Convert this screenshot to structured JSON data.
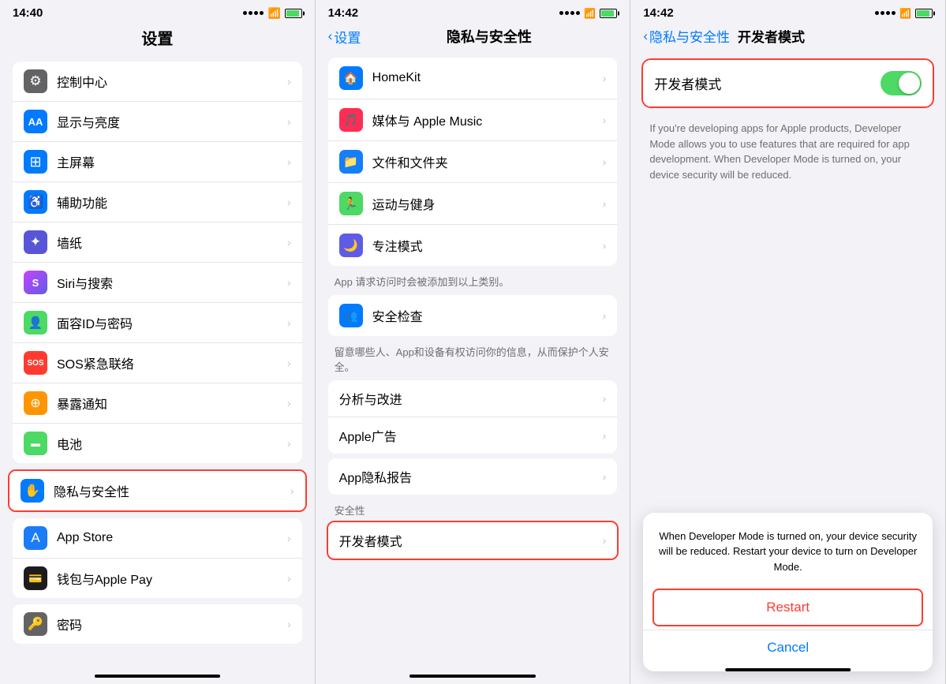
{
  "panel1": {
    "time": "14:40",
    "title": "设置",
    "items": [
      {
        "icon": "⚙",
        "iconClass": "ic-control",
        "label": "控制中心",
        "iconText": "◉"
      },
      {
        "icon": "AA",
        "iconClass": "ic-display",
        "label": "显示与亮度",
        "iconText": "AA"
      },
      {
        "icon": "⊞",
        "iconClass": "ic-home",
        "label": "主屏幕",
        "iconText": "⊞"
      },
      {
        "icon": "♿",
        "iconClass": "ic-accessibility",
        "label": "辅助功能",
        "iconText": "♿"
      },
      {
        "icon": "🖼",
        "iconClass": "ic-wallpaper",
        "label": "墙纸",
        "iconText": "✦"
      },
      {
        "icon": "S",
        "iconClass": "ic-siri",
        "label": "Siri与搜索",
        "iconText": "S"
      },
      {
        "icon": "👤",
        "iconClass": "ic-faceid",
        "label": "面容ID与密码",
        "iconText": "👤"
      },
      {
        "icon": "SOS",
        "iconClass": "ic-sos",
        "label": "SOS紧急联络",
        "iconText": "SOS"
      },
      {
        "icon": "⊕",
        "iconClass": "ic-exposure",
        "label": "暴露通知",
        "iconText": "⊕"
      },
      {
        "icon": "▬",
        "iconClass": "ic-battery",
        "label": "电池",
        "iconText": "▬"
      },
      {
        "icon": "✋",
        "iconClass": "ic-privacy",
        "label": "隐私与安全性",
        "iconText": "✋"
      },
      {
        "icon": "A",
        "iconClass": "ic-appstore",
        "label": "App Store",
        "iconText": "A"
      },
      {
        "icon": "💳",
        "iconClass": "ic-wallet",
        "label": "钱包与Apple Pay",
        "iconText": "💳"
      },
      {
        "icon": "🔑",
        "iconClass": "ic-passcode",
        "label": "密码",
        "iconText": "🔑"
      }
    ]
  },
  "panel2": {
    "time": "14:42",
    "backLabel": "设置",
    "title": "隐私与安全性",
    "items": [
      {
        "icon": "🏠",
        "iconClass": "ic-home",
        "label": "HomeKit",
        "iconText": "🏠"
      },
      {
        "icon": "🎵",
        "iconClass": "ic-sos",
        "label": "媒体与 Apple Music",
        "iconText": "🎵"
      },
      {
        "icon": "📁",
        "iconClass": "ic-appstore",
        "label": "文件和文件夹",
        "iconText": "📁"
      },
      {
        "icon": "🏃",
        "iconClass": "ic-faceid",
        "label": "运动与健身",
        "iconText": "🏃"
      },
      {
        "icon": "🌙",
        "iconClass": "ic-wallpaper",
        "label": "专注模式",
        "iconText": "🌙"
      }
    ],
    "appNote": "App 请求访问时会被添加到以上类别。",
    "safetyItems": [
      {
        "icon": "👥",
        "iconClass": "ic-privacy",
        "label": "安全检查",
        "iconText": "👥"
      }
    ],
    "safetyNote": "留意哪些人、App和设备有权访问你的信息，从而保护个人安全。",
    "moreItems": [
      {
        "label": "分析与改进"
      },
      {
        "label": "Apple广告"
      }
    ],
    "privacyReport": "App隐私报告",
    "safetySection": "安全性",
    "developerMode": "开发者模式"
  },
  "panel3": {
    "time": "14:42",
    "backLabel": "隐私与安全性",
    "title": "开发者模式",
    "toggleLabel": "开发者模式",
    "toggleOn": true,
    "description": "If you're developing apps for Apple products, Developer Mode allows you to use features that are required for app development. When Developer Mode is turned on, your device security will be reduced.",
    "alertText": "When Developer Mode is turned on, your device security will be reduced. Restart your device to turn on Developer Mode.",
    "restartLabel": "Restart",
    "cancelLabel": "Cancel"
  }
}
